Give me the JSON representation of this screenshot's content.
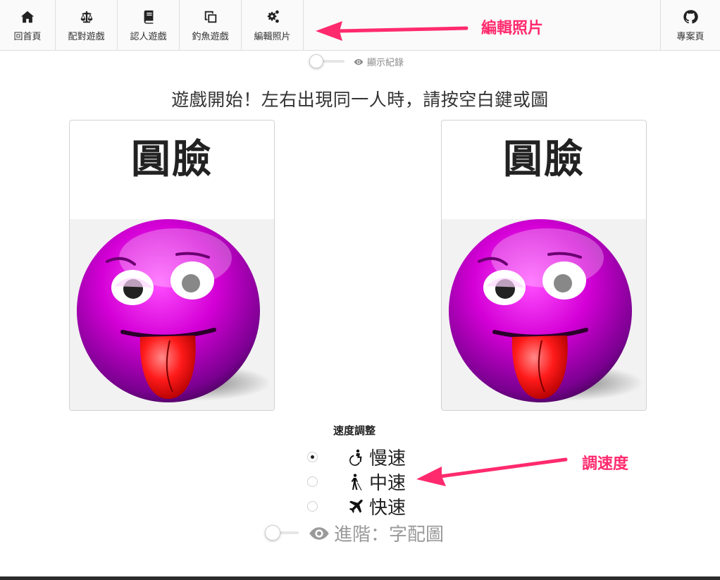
{
  "nav": {
    "items": [
      {
        "label": "回首頁",
        "icon": "home-icon"
      },
      {
        "label": "配對遊戲",
        "icon": "balance-scale-icon"
      },
      {
        "label": "認人遊戲",
        "icon": "book-icon"
      },
      {
        "label": "釣魚遊戲",
        "icon": "clone-icon"
      },
      {
        "label": "編輯照片",
        "icon": "gears-icon"
      }
    ],
    "project": {
      "label": "專案頁",
      "icon": "github-icon"
    }
  },
  "annotations": {
    "edit_photo": "編輯照片",
    "adjust_speed": "調速度",
    "color": "#ff2a6d"
  },
  "history_toggle": {
    "label": "顯示紀錄",
    "on": false
  },
  "instruction": "遊戲開始！左右出現同一人時，請按空白鍵或圖",
  "cards": [
    {
      "title": "圓臉",
      "image": "purple-smiley-tongue-out"
    },
    {
      "title": "圓臉",
      "image": "purple-smiley-tongue-out"
    }
  ],
  "speed": {
    "title": "速度調整",
    "options": [
      {
        "label": "慢速",
        "icon": "wheelchair-icon",
        "checked": true
      },
      {
        "label": "中速",
        "icon": "blind-walker-icon",
        "checked": false
      },
      {
        "label": "快速",
        "icon": "plane-icon",
        "checked": false
      }
    ]
  },
  "advanced_toggle": {
    "label": "進階：字配圖",
    "on": false
  }
}
